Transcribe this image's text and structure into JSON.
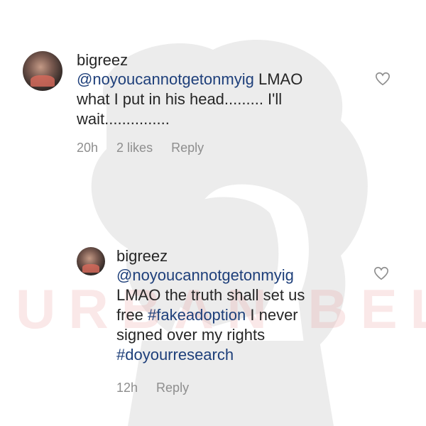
{
  "comments": [
    {
      "username": "bigreez",
      "mention": "@noyoucannotgetonmyig",
      "text_after_mention": " LMAO\nwhat I put in his head......... I'll\nwait...............",
      "time": "20h",
      "likes": "2 likes",
      "reply": "Reply",
      "icons": {
        "avatar": "profile-avatar",
        "heart": "heart-outline-icon"
      }
    },
    {
      "username": "bigreez",
      "mention": "@noyoucannotgetonmyig",
      "text_line2": "LMAO the truth shall set us",
      "text_line3_pre": "free ",
      "hashtag1": "#fakeadoption",
      "text_line3_post": " I never",
      "text_line4": "signed over my rights",
      "hashtag2": "#doyourresearch",
      "time": "12h",
      "reply": "Reply",
      "icons": {
        "avatar": "profile-avatar",
        "heart": "heart-outline-icon"
      }
    }
  ],
  "watermark": "URBAN BELLE",
  "colors": {
    "text": "#262626",
    "link": "#1e3f7a",
    "meta": "#8e8e8e",
    "watermark": "#e89696"
  }
}
